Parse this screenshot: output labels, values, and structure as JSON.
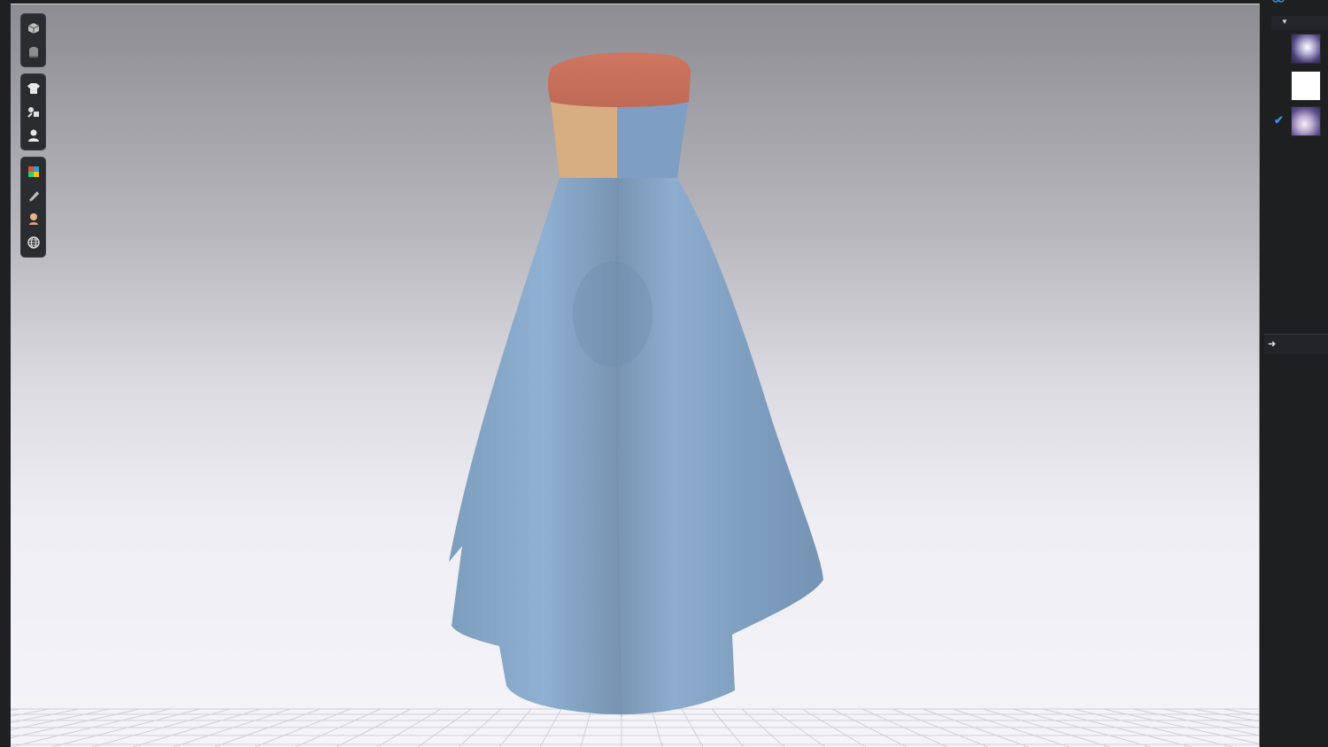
{
  "viewport": {
    "toolbar": {
      "group1": [
        {
          "name": "view-cube-icon"
        },
        {
          "name": "garment-layer-icon"
        }
      ],
      "group2": [
        {
          "name": "shirt-icon"
        },
        {
          "name": "brush-tools-icon"
        },
        {
          "name": "avatar-icon"
        }
      ],
      "group3": [
        {
          "name": "color-palette-icon"
        },
        {
          "name": "fabric-render-icon"
        },
        {
          "name": "skin-icon"
        },
        {
          "name": "globe-icon"
        }
      ]
    }
  },
  "right_panel": {
    "header_arrow": "▼",
    "thumbnails": [
      {
        "name": "thumbnail-1",
        "selected": false
      },
      {
        "name": "thumbnail-2",
        "selected": false
      },
      {
        "name": "thumbnail-3",
        "selected": true
      }
    ],
    "check_mark": "✔",
    "sub_arrow": "➜"
  },
  "colors": {
    "bodice_top": "#c9705e",
    "bodice_left": "#d7ad82",
    "dress_blue": "#87a9cc",
    "accent_check": "#3f8fe6"
  }
}
